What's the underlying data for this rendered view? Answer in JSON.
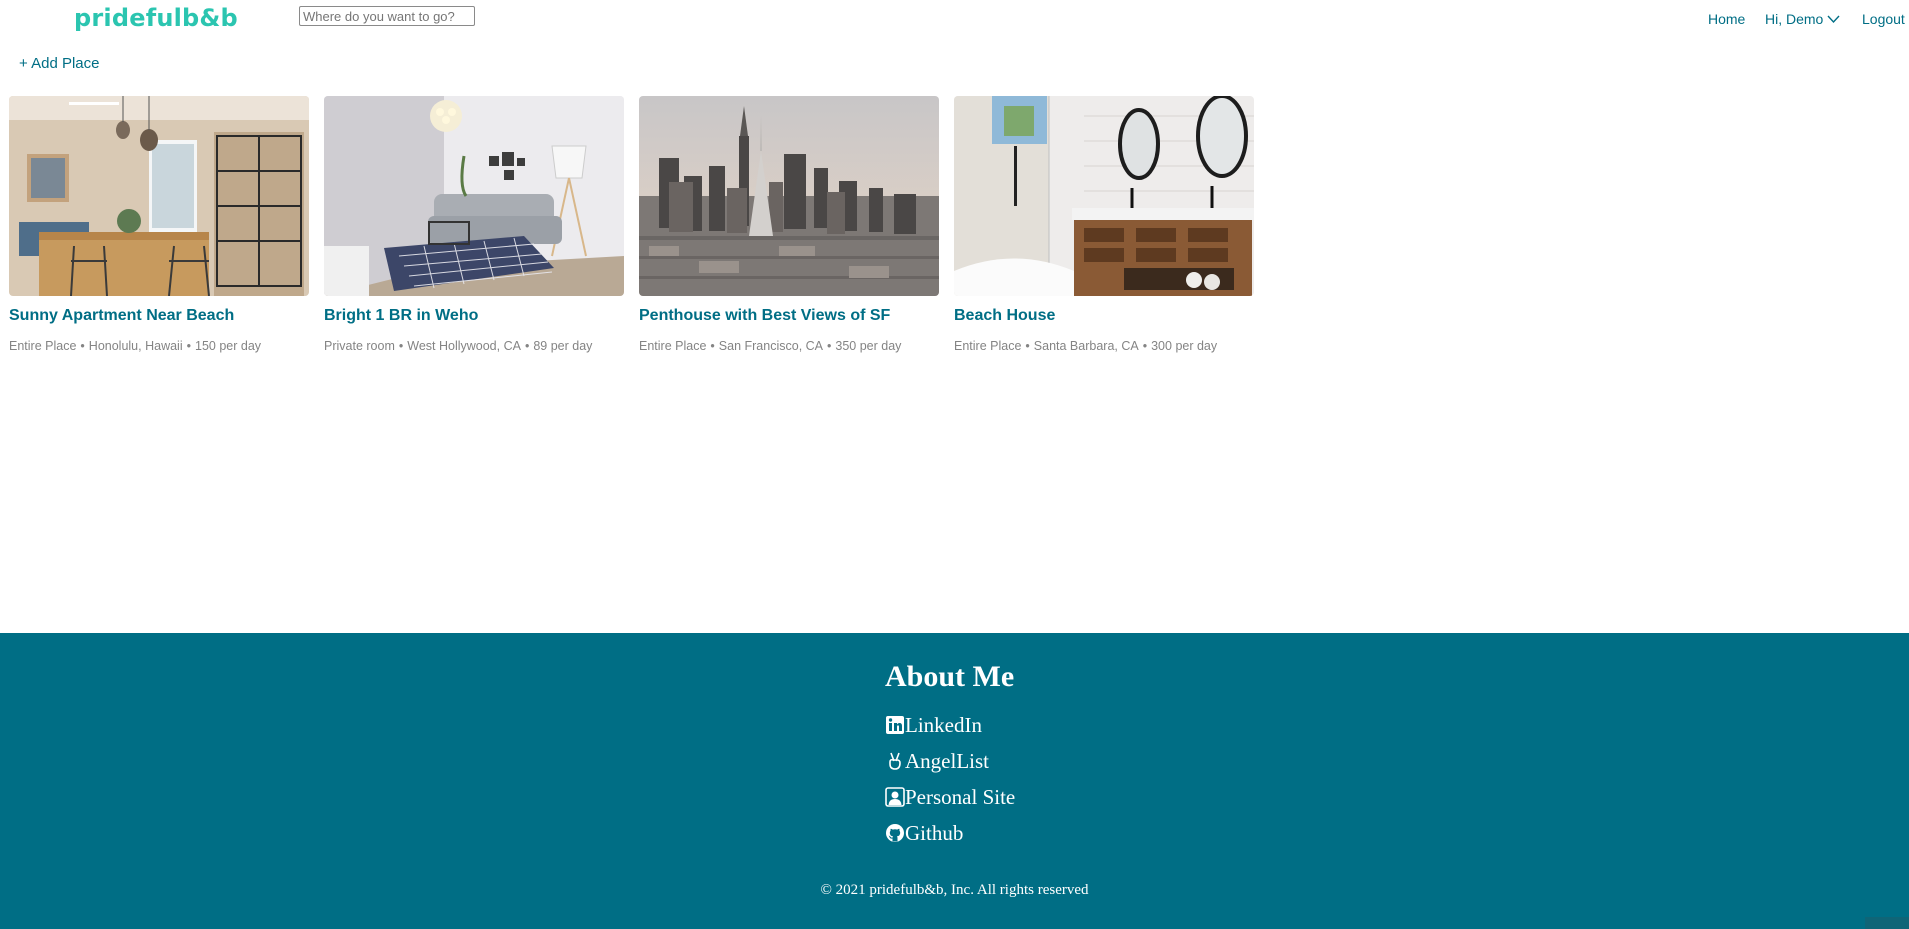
{
  "header": {
    "logo": "pridefulb&b",
    "search_placeholder": "Where do you want to go?",
    "nav": {
      "home": "Home",
      "user": "Hi, Demo",
      "logout": "Logout"
    }
  },
  "toolbar": {
    "add_place": "+ Add Place"
  },
  "listings": [
    {
      "title": "Sunny Apartment Near Beach",
      "type": "Entire Place",
      "location": "Honolulu, Hawaii",
      "price": "150 per day",
      "separator": "•"
    },
    {
      "title": "Bright 1 BR in Weho",
      "type": "Private room",
      "location": "West Hollywood, CA",
      "price": "89 per day",
      "separator": "•"
    },
    {
      "title": "Penthouse with Best Views of SF",
      "type": "Entire Place",
      "location": "San Francisco, CA",
      "price": "350 per day",
      "separator": "•"
    },
    {
      "title": "Beach House",
      "type": "Entire Place",
      "location": "Santa Barbara, CA",
      "price": "300 per day",
      "separator": "•"
    }
  ],
  "footer": {
    "heading": "About Me",
    "links": [
      {
        "label": "LinkedIn",
        "icon": "linkedin-icon"
      },
      {
        "label": "AngelList",
        "icon": "angellist-icon"
      },
      {
        "label": "Personal Site",
        "icon": "personal-site-icon"
      },
      {
        "label": "Github",
        "icon": "github-icon"
      }
    ],
    "copyright_symbol": "©",
    "copyright": "2021 pridefulb&b, Inc. All rights reserved"
  },
  "colors": {
    "brand": "#2bc5b0",
    "accent": "#006e85",
    "footer_bg": "#006e85",
    "meta_text": "#848484"
  }
}
